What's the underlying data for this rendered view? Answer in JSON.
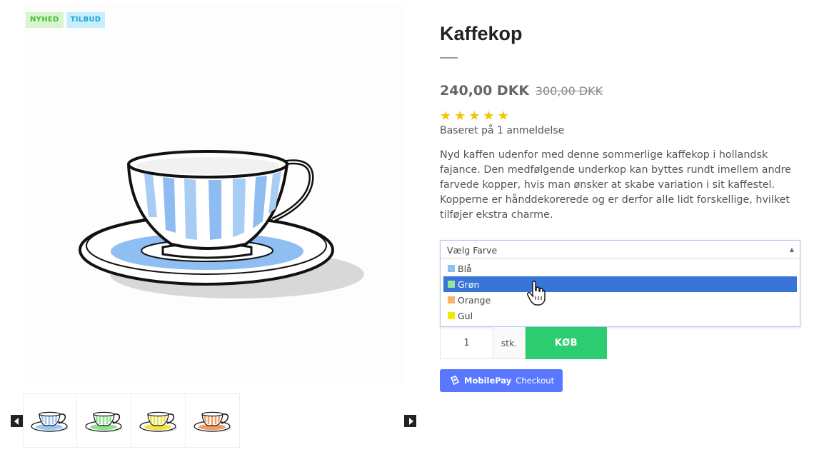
{
  "badges": {
    "new": "NYHED",
    "sale": "TILBUD"
  },
  "product": {
    "title": "Kaffekop",
    "price": "240,00 DKK",
    "old_price": "300,00 DKK",
    "rating": 5,
    "rating_max": 5,
    "review_text": "Baseret på 1 anmeldelse",
    "description": "Nyd kaffen udenfor med denne sommerlige kaffekop i hollandsk fajance. Den medfølgende underkop kan byttes rundt imellem andre farvede kopper, hvis man ønsker at skabe variation i sit kaffestel. Kopperne er hånddekorerede og er derfor alle lidt forskellige, hvilket tilføjer ekstra charme."
  },
  "color_select": {
    "placeholder": "Vælg Farve",
    "options": [
      {
        "label": "Blå",
        "color": "#8ec0f2"
      },
      {
        "label": "Grøn",
        "color": "#9ae59a"
      },
      {
        "label": "Orange",
        "color": "#f7b46a"
      },
      {
        "label": "Gul",
        "color": "#f5e800"
      }
    ],
    "highlighted": "Grøn"
  },
  "purchase": {
    "quantity": "1",
    "unit": "stk.",
    "buy_label": "KØB"
  },
  "mobilepay": {
    "brand": "MobilePay",
    "label": "Checkout"
  },
  "thumbnails": [
    {
      "name": "blue-cup",
      "color": "#9cc7f3"
    },
    {
      "name": "green-cup",
      "color": "#8fe08f"
    },
    {
      "name": "yellow-cup",
      "color": "#f2e23c"
    },
    {
      "name": "orange-cup",
      "color": "#f39a5c"
    }
  ],
  "colors": {
    "buy": "#2ecc71",
    "select_highlight": "#3875d7",
    "mobilepay": "#5a78ff",
    "star": "#f5c400"
  }
}
